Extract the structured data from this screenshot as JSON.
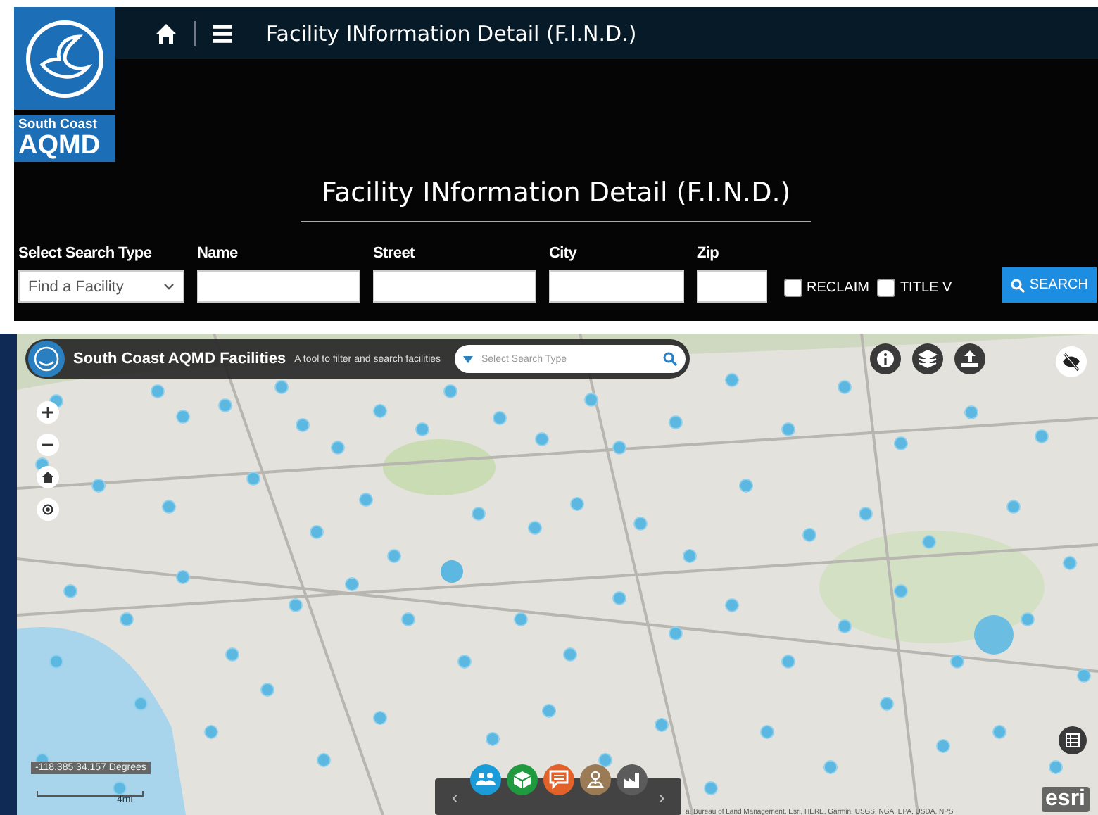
{
  "header": {
    "title": "Facility INformation Detail (F.I.N.D.)",
    "logo": {
      "line1": "South Coast",
      "line2": "AQMD"
    }
  },
  "page_title": "Facility INformation Detail (F.I.N.D.)",
  "search_form": {
    "fields": [
      {
        "kind": "select",
        "label": "Select Search Type",
        "value": "Find a Facility"
      },
      {
        "kind": "text",
        "label": "Name"
      },
      {
        "kind": "text",
        "label": "Street"
      },
      {
        "kind": "text",
        "label": "City"
      },
      {
        "kind": "short",
        "label": "Zip"
      }
    ],
    "checkboxes": [
      {
        "label": "RECLAIM",
        "checked": false
      },
      {
        "label": "TITLE V",
        "checked": false
      }
    ],
    "button": "SEARCH"
  },
  "map": {
    "title": "South Coast AQMD Facilities",
    "subtitle": "A tool to filter and search facilities",
    "search_placeholder": "Select Search Type",
    "coordinates": "-118.385 34.157 Degrees",
    "scale": "4mi",
    "attribution": "a, Bureau of Land Management, Esri, HERE, Garmin, USGS, NGA, EPA, USDA, NPS",
    "logo": "esri",
    "prev": "‹",
    "next": "›",
    "tools": [
      {
        "kind": "people",
        "color": "#1b9bd7"
      },
      {
        "kind": "box",
        "color": "#1f9a3e"
      },
      {
        "kind": "comment",
        "color": "#e2622a"
      },
      {
        "kind": "pin",
        "color": "#9b7a56"
      },
      {
        "kind": "factory",
        "color": "#5b5b5b"
      }
    ]
  }
}
